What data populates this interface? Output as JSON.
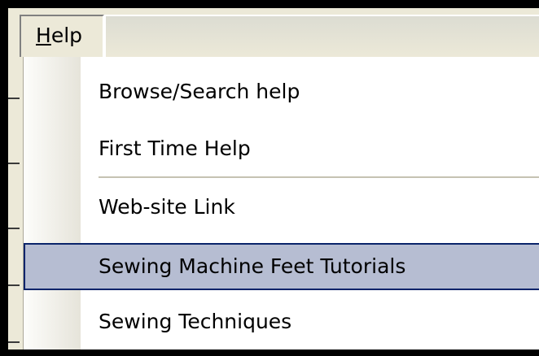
{
  "menubar": {
    "help_menu": {
      "accelerator": "H",
      "rest": "elp"
    }
  },
  "help_dropdown": {
    "items": [
      {
        "label": "Browse/Search help",
        "selected": false
      },
      {
        "label": "First Time Help",
        "selected": false
      },
      {
        "label": "Web-site Link",
        "selected": false
      },
      {
        "label": "Sewing Machine Feet Tutorials",
        "selected": true
      },
      {
        "label": "Sewing Techniques",
        "selected": false
      }
    ]
  },
  "colors": {
    "menu_background": "#ece9d8",
    "dropdown_background": "#ffffff",
    "highlight_fill": "#b6bdd2",
    "highlight_border": "#0a246a",
    "separator": "#c5c2b2"
  }
}
